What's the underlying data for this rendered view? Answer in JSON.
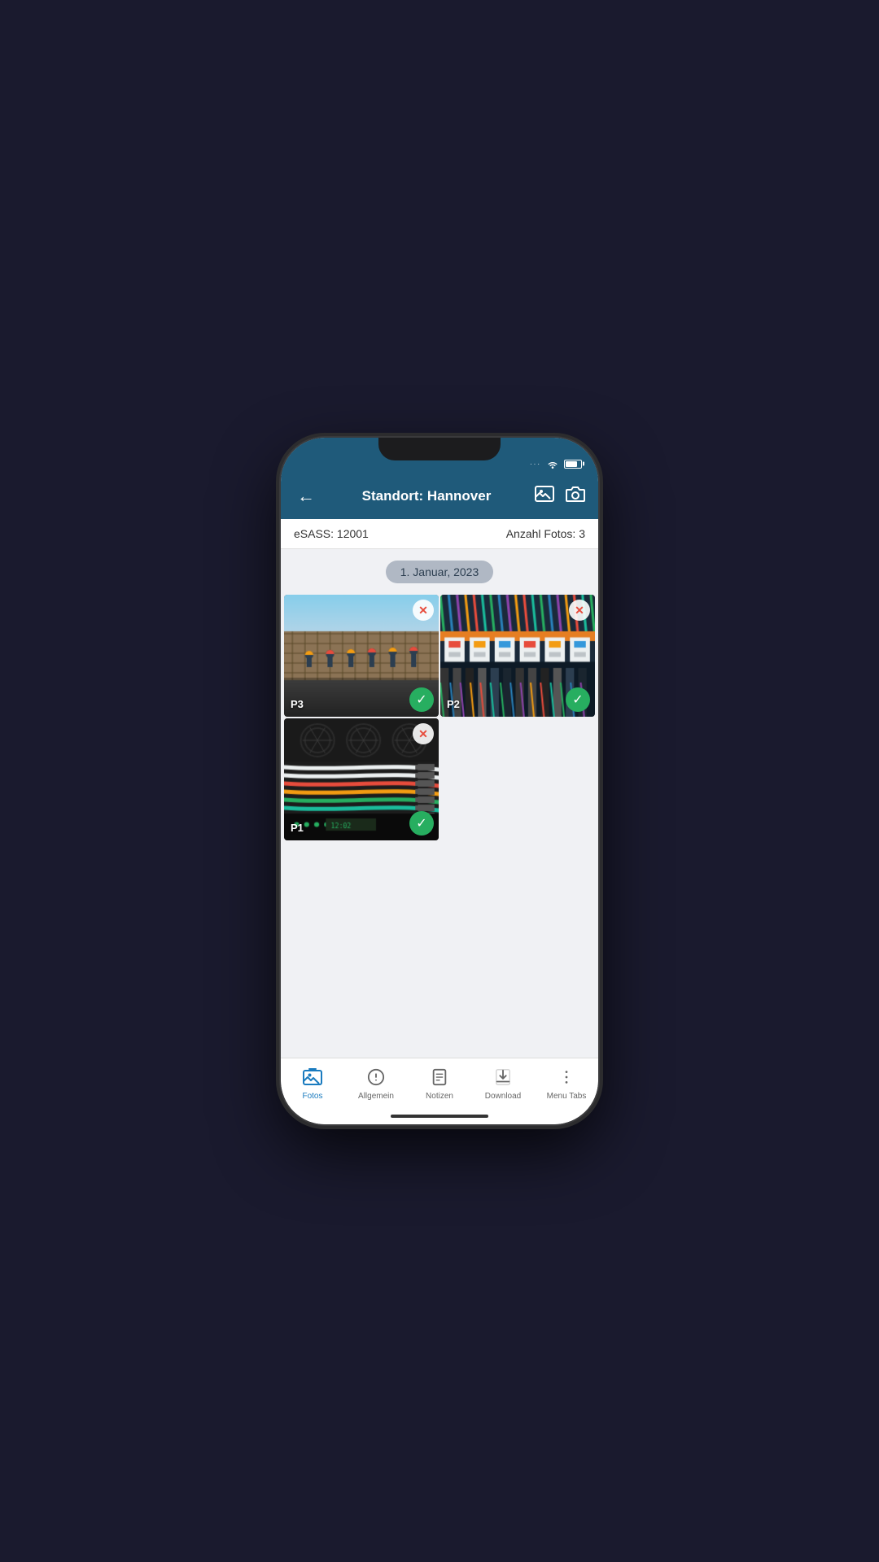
{
  "statusBar": {
    "dots": "···"
  },
  "header": {
    "backLabel": "←",
    "title": "Standort: Hannover",
    "imageIconLabel": "🖼",
    "cameraIconLabel": "📷"
  },
  "subHeader": {
    "esass": "eSASS: 12001",
    "anzahl": "Anzahl Fotos: 3"
  },
  "dateChip": {
    "label": "1. Januar, 2023"
  },
  "photos": [
    {
      "id": "photo-p3",
      "label": "P3",
      "hasDelete": true,
      "hasCheck": true,
      "type": "construction",
      "position": "top-left"
    },
    {
      "id": "photo-p2",
      "label": "P2",
      "hasDelete": true,
      "hasCheck": true,
      "type": "electrical",
      "position": "top-right"
    },
    {
      "id": "photo-p1",
      "label": "P1",
      "hasDelete": true,
      "hasCheck": true,
      "type": "network",
      "position": "bottom-left"
    }
  ],
  "bottomNav": {
    "items": [
      {
        "id": "fotos",
        "label": "Fotos",
        "icon": "📷",
        "active": true
      },
      {
        "id": "allgemein",
        "label": "Allgemein",
        "icon": "ℹ",
        "active": false
      },
      {
        "id": "notizen",
        "label": "Notizen",
        "icon": "📋",
        "active": false
      },
      {
        "id": "download",
        "label": "Download",
        "icon": "⬇",
        "active": false
      },
      {
        "id": "menu-tabs",
        "label": "Menu Tabs",
        "icon": "⋮",
        "active": false
      }
    ]
  }
}
